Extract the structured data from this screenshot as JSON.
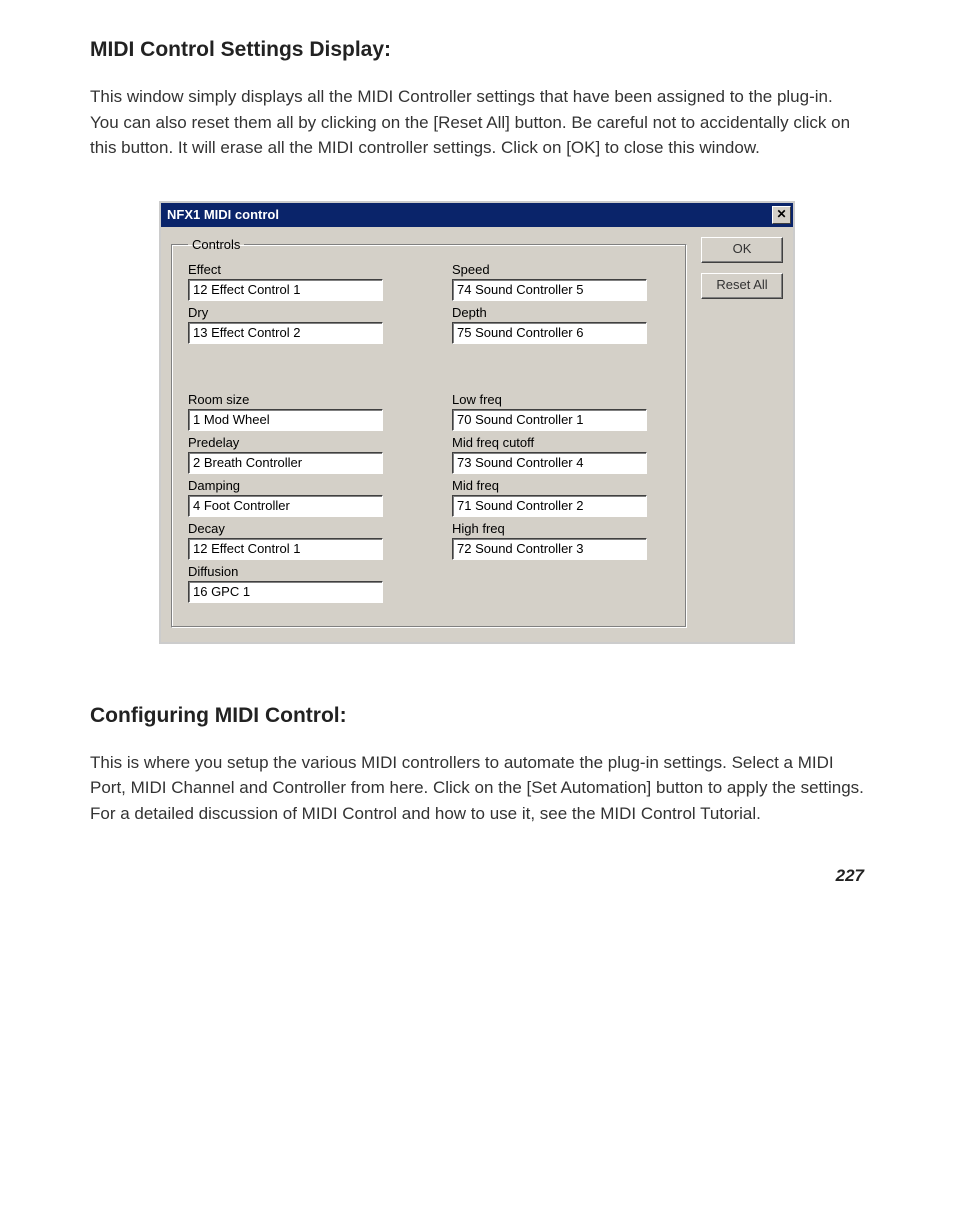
{
  "heading1": "MIDI Control Settings Display:",
  "para1": "This window simply displays all the MIDI Controller settings that have been assigned to the plug-in.  You can also reset them all by clicking on the [Reset All] button.\nBe careful not to accidentally click on this button.  It will erase all the MIDI controller settings.  Click on [OK] to close this window.",
  "dialog": {
    "title": "NFX1 MIDI control",
    "close_glyph": "✕",
    "legend": "Controls",
    "ok_label": "OK",
    "reset_label": "Reset All",
    "left": [
      {
        "label": "Effect",
        "value": "12 Effect Control 1"
      },
      {
        "label": "Dry",
        "value": "13 Effect Control 2"
      },
      {
        "label": "Room size",
        "value": "1 Mod Wheel"
      },
      {
        "label": "Predelay",
        "value": "2 Breath Controller"
      },
      {
        "label": "Damping",
        "value": "4 Foot Controller"
      },
      {
        "label": "Decay",
        "value": "12 Effect Control 1"
      },
      {
        "label": "Diffusion",
        "value": "16 GPC 1"
      }
    ],
    "right": [
      {
        "label": "Speed",
        "value": "74 Sound Controller 5"
      },
      {
        "label": "Depth",
        "value": "75 Sound Controller 6"
      },
      {
        "label": "Low freq",
        "value": "70 Sound Controller 1"
      },
      {
        "label": "Mid freq cutoff",
        "value": "73 Sound Controller 4"
      },
      {
        "label": "Mid freq",
        "value": "71 Sound Controller 2"
      },
      {
        "label": "High freq",
        "value": "72 Sound Controller 3"
      }
    ]
  },
  "heading2": "Configuring MIDI Control:",
  "para2": "This is where you setup the various MIDI controllers to automate the plug-in settings.  Select a MIDI Port, MIDI Channel and Controller from here.  Click on the [Set Automation] button to apply the settings.  For a detailed discussion of MIDI Control and how to use it, see the MIDI Control Tutorial.",
  "page_number": "227"
}
